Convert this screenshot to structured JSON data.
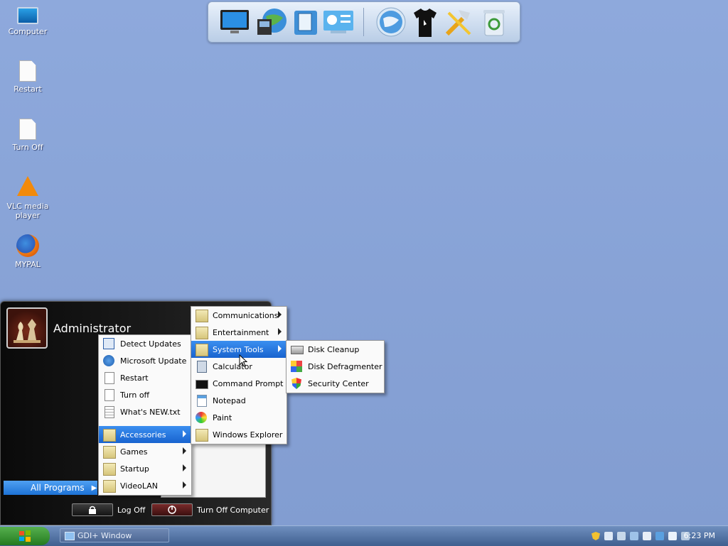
{
  "desktop": {
    "icons": [
      {
        "label": "Computer",
        "icon": "computer-icon"
      },
      {
        "label": "Restart",
        "icon": "restart-shortcut-icon"
      },
      {
        "label": "Turn Off",
        "icon": "turn-off-shortcut-icon"
      },
      {
        "label": "VLC media player",
        "icon": "vlc-icon"
      },
      {
        "label": "MYPAL",
        "icon": "mypal-browser-icon"
      }
    ]
  },
  "dock": {
    "items": [
      {
        "icon": "monitor-icon"
      },
      {
        "icon": "globe-network-icon"
      },
      {
        "icon": "documents-icon"
      },
      {
        "icon": "control-panel-icon"
      },
      {
        "icon": "internet-globe-icon"
      },
      {
        "icon": "tshirt-theme-icon"
      },
      {
        "icon": "tools-icon"
      },
      {
        "icon": "recycle-bin-icon"
      }
    ]
  },
  "start_menu": {
    "user_name": "Administrator",
    "all_programs_label": "All Programs",
    "log_off_label": "Log Off",
    "turn_off_label": "Turn Off Computer"
  },
  "programs_menu": {
    "items": [
      {
        "label": "Detect Updates",
        "icon": "monitor-icon"
      },
      {
        "label": "Microsoft Update",
        "icon": "windows-update-icon"
      },
      {
        "label": "Restart",
        "icon": "document-icon"
      },
      {
        "label": "Turn off",
        "icon": "document-icon"
      },
      {
        "label": "What's NEW.txt",
        "icon": "text-file-icon"
      },
      {
        "label": "Accessories",
        "icon": "folder-icon",
        "selected": true,
        "has_submenu": true
      },
      {
        "label": "Games",
        "icon": "folder-icon",
        "has_submenu": true
      },
      {
        "label": "Startup",
        "icon": "folder-icon",
        "has_submenu": true
      },
      {
        "label": "VideoLAN",
        "icon": "folder-icon",
        "has_submenu": true
      }
    ]
  },
  "accessories_menu": {
    "items": [
      {
        "label": "Communications",
        "icon": "folder-icon",
        "has_submenu": true
      },
      {
        "label": "Entertainment",
        "icon": "folder-icon",
        "has_submenu": true
      },
      {
        "label": "System Tools",
        "icon": "folder-icon",
        "has_submenu": true,
        "selected": true
      },
      {
        "label": "Calculator",
        "icon": "calculator-icon"
      },
      {
        "label": "Command Prompt",
        "icon": "command-prompt-icon"
      },
      {
        "label": "Notepad",
        "icon": "notepad-icon"
      },
      {
        "label": "Paint",
        "icon": "paint-icon"
      },
      {
        "label": "Windows Explorer",
        "icon": "explorer-folder-icon"
      }
    ]
  },
  "system_tools_menu": {
    "items": [
      {
        "label": "Disk Cleanup",
        "icon": "disk-cleanup-icon"
      },
      {
        "label": "Disk Defragmenter",
        "icon": "defragmenter-icon"
      },
      {
        "label": "Security Center",
        "icon": "security-shield-icon"
      }
    ]
  },
  "taskbar": {
    "window_label": "GDI+ Window",
    "clock": "6:23 PM"
  },
  "colors": {
    "desktop": "#8aa6d8",
    "selection": "#1e6fd6",
    "taskbar": "#4f6f9f",
    "start_button": "#2f8f2a"
  }
}
